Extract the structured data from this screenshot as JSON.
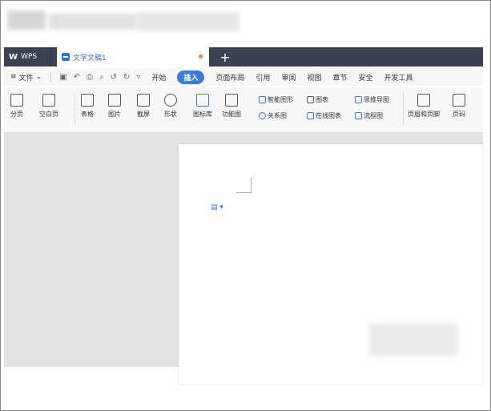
{
  "wps": {
    "label": "WPS"
  },
  "doc_tab": {
    "title": "文字文稿1"
  },
  "new_tab": "+",
  "menu": {
    "file": "文件",
    "items": [
      "开始",
      "插入",
      "页面布局",
      "引用",
      "审阅",
      "视图",
      "章节",
      "安全",
      "开发工具"
    ]
  },
  "ribbon": {
    "blank_page": "分页",
    "empty_page": "空白页",
    "table": "表格",
    "picture": "图片",
    "screenshot": "截屏",
    "shapes": "形状",
    "icon_lib": "图标库",
    "function_chart": "功能图",
    "smart_graphic": "智能图形",
    "chart": "图表",
    "mindmap": "思维导图",
    "relation": "关系图",
    "online_chart": "在线图表",
    "flowchart": "流程图",
    "header_footer": "页眉和页脚",
    "page_number": "页码"
  }
}
